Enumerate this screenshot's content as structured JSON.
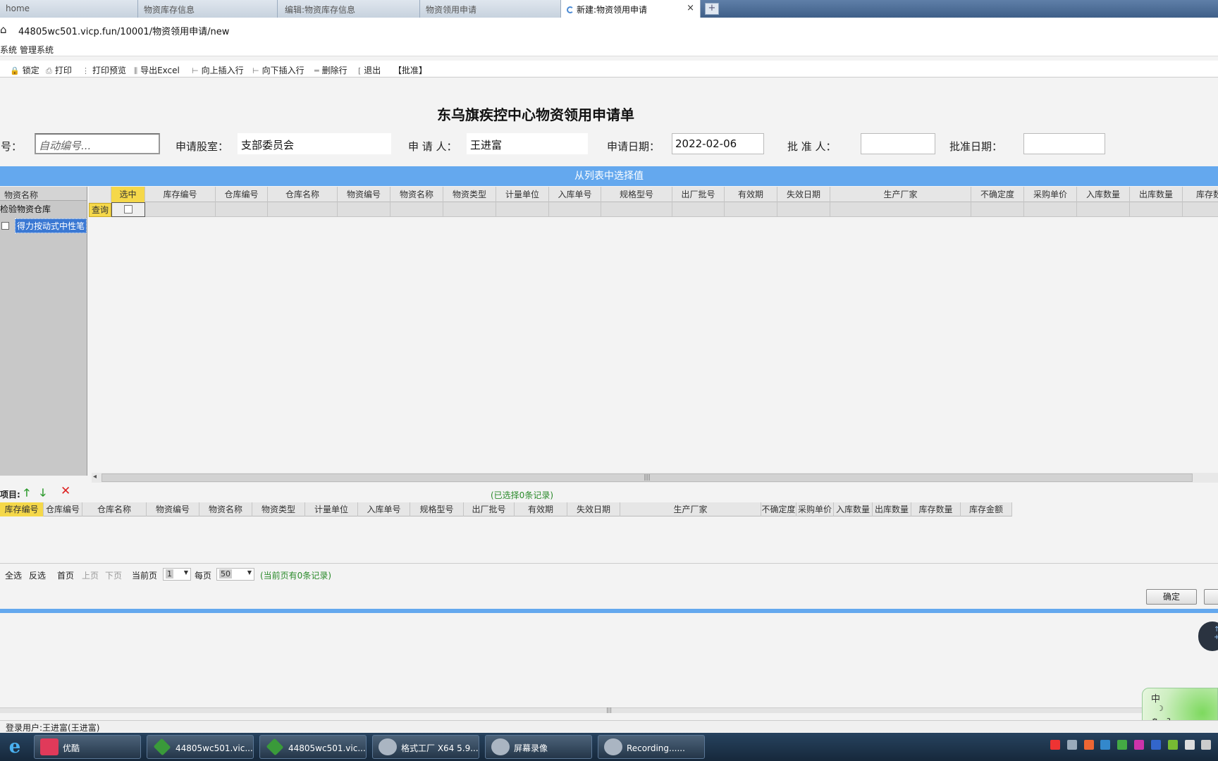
{
  "tabs": [
    {
      "label": "home"
    },
    {
      "label": "物资库存信息"
    },
    {
      "label": "编辑:物资库存信息"
    },
    {
      "label": "物资领用申请"
    },
    {
      "label": "新建:物资领用申请",
      "close": "×"
    }
  ],
  "newtab_symbol": "+",
  "address": {
    "url": "44805wc501.vicp.fun/10001/物资领用申请/new"
  },
  "menu": [
    "系统",
    "管理系统"
  ],
  "toolbar": [
    {
      "icon": "lock-icon",
      "label": "锁定"
    },
    {
      "icon": "print-icon",
      "label": "打印"
    },
    {
      "icon": "print-preview-icon",
      "label": "打印预览"
    },
    {
      "icon": "excel-icon",
      "label": "导出Excel"
    },
    {
      "icon": "insert-above-icon",
      "label": "向上插入行"
    },
    {
      "icon": "insert-below-icon",
      "label": "向下插入行"
    },
    {
      "icon": "delete-row-icon",
      "label": "删除行"
    },
    {
      "icon": "exit-icon",
      "label": "退出"
    },
    {
      "icon": "",
      "label": "【批准】"
    }
  ],
  "form": {
    "title": "东乌旗疾控中心物资领用申请单",
    "number_label": "编号：",
    "number_placeholder": "自动编号...",
    "dept_label": "申请股室：",
    "dept_value": "支部委员会",
    "applicant_label": "申 请 人：",
    "applicant_value": "王进富",
    "date_label": "申请日期：",
    "date_value": "2022-02-06",
    "approver_label": "批 准 人：",
    "approver_value": "",
    "approve_date_label": "批准日期：",
    "approve_date_value": ""
  },
  "selector": {
    "header": "从列表中选择值",
    "tree_header": "物资名称",
    "tree_root": "检验物资仓库",
    "tree_leaf": "得力按动式中性笔",
    "query_label": "查询",
    "columns": [
      "选中",
      "库存编号",
      "仓库编号",
      "仓库名称",
      "物资编号",
      "物资名称",
      "物资类型",
      "计量单位",
      "入库单号",
      "规格型号",
      "出厂批号",
      "有效期",
      "失效日期",
      "生产厂家",
      "不确定度",
      "采购单价",
      "入库数量",
      "出库数量",
      "库存数"
    ]
  },
  "selected": {
    "label": "项目:",
    "count_text": "(已选择0条记录)",
    "columns": [
      "库存编号",
      "仓库编号",
      "仓库名称",
      "物资编号",
      "物资名称",
      "物资类型",
      "计量单位",
      "入库单号",
      "规格型号",
      "出厂批号",
      "有效期",
      "失效日期",
      "生产厂家",
      "不确定度",
      "采购单价",
      "入库数量",
      "出库数量",
      "库存数量",
      "库存金额"
    ]
  },
  "pager": {
    "select_all": "全选",
    "invert": "反选",
    "first": "首页",
    "prev": "上页",
    "next": "下页",
    "current_label": "当前页",
    "current_value": "1",
    "per_page_label": "每页",
    "per_page_value": "50",
    "info": "(当前页有0条记录)"
  },
  "ok_label": "确定",
  "status": {
    "user": "登录用户:王进富(王进富)"
  },
  "ime": {
    "mode": "中"
  },
  "taskbar": [
    {
      "label": "优酷",
      "icon": "youku-icon"
    },
    {
      "label": "44805wc501.vic...",
      "icon": "app-icon"
    },
    {
      "label": "44805wc501.vic...",
      "icon": "app-icon"
    },
    {
      "label": "格式工厂 X64 5.9...",
      "icon": "format-factory-icon"
    },
    {
      "label": "屏幕录像",
      "icon": "recorder-icon"
    },
    {
      "label": "Recording......",
      "icon": "recorder-icon"
    }
  ],
  "colors": {
    "accent": "#64a8ee",
    "header_selected": "#f5d84a",
    "success_text": "#2a8a2a",
    "danger": "#d22222"
  }
}
